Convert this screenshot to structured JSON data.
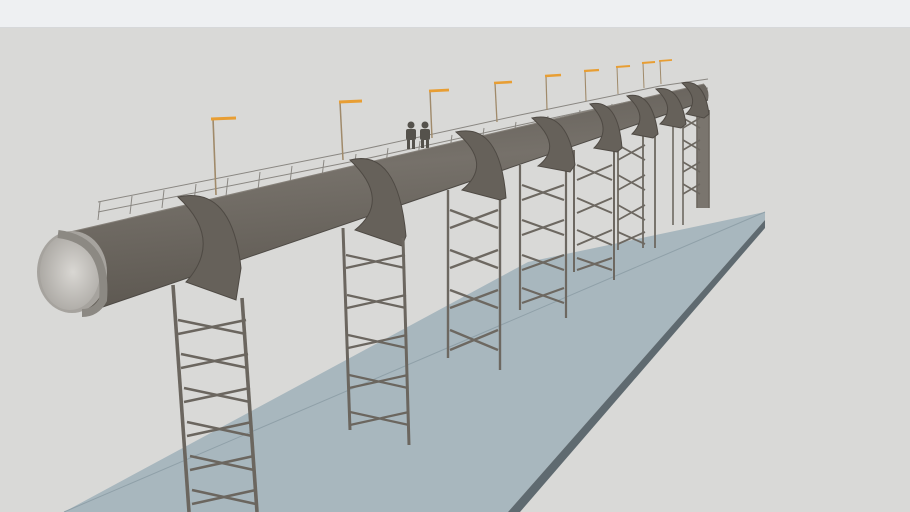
{
  "viewport": {
    "background": "#d9d9d7",
    "ground_color": "#a7b6bd",
    "pipe_color": "#6f6a64",
    "steel_color": "#7c7770",
    "lamp_color": "#e8a23a"
  },
  "scene": {
    "objects": [
      "pipeline",
      "ground-slab",
      "support-towers",
      "walkway-railing",
      "street-lamps",
      "workers"
    ]
  }
}
